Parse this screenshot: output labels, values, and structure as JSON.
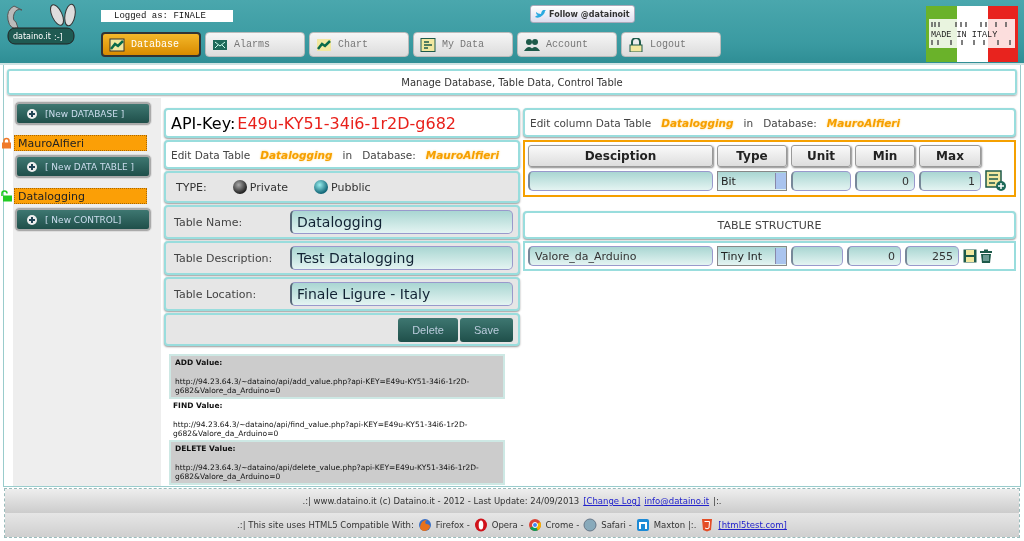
{
  "header": {
    "logo_text": "dataino.it",
    "logo_face": ":-]",
    "logged_as": "Logged as: FINALE",
    "twitter_button": "Follow @datainoit",
    "badge": "MADE IN ITALY",
    "nav": [
      {
        "label": "Database",
        "selected": true
      },
      {
        "label": "Alarms",
        "selected": false
      },
      {
        "label": "Chart",
        "selected": false
      },
      {
        "label": "My Data",
        "selected": false
      },
      {
        "label": "Account",
        "selected": false
      },
      {
        "label": "Logout",
        "selected": false
      }
    ]
  },
  "page_title": "Manage Database, Table Data, Control Table",
  "sidebar": {
    "items": [
      {
        "kind": "button",
        "label": "[New DATABASE ]"
      },
      {
        "kind": "entry",
        "label": "MauroAlfieri",
        "locked": true
      },
      {
        "kind": "button",
        "label": "[ New DATA TABLE ]"
      },
      {
        "kind": "entry",
        "label": "Datalogging",
        "locked": false
      },
      {
        "kind": "button",
        "label": "[ New CONTROL]"
      }
    ]
  },
  "api_key": {
    "label": "API-Key:",
    "value": "E49u-KY51-34i6-1r2D-g682"
  },
  "edit_table": {
    "prefix": "Edit Data Table",
    "table": "Datalogging",
    "in": "in",
    "database_label": "Database:",
    "database": "MauroAlfieri"
  },
  "type_row": {
    "label": "TYPE:",
    "options": [
      {
        "label": "Private",
        "selected": false
      },
      {
        "label": "Pubblic",
        "selected": true
      }
    ]
  },
  "fields": [
    {
      "label": "Table Name:",
      "value": "Datalogging"
    },
    {
      "label": "Table Description:",
      "value": "Test Datalogging"
    },
    {
      "label": "Table Location:",
      "value": "Finale Ligure - Italy"
    }
  ],
  "buttons": [
    "Delete",
    "Save"
  ],
  "api_examples": [
    {
      "title": "ADD Value:",
      "url": "http://94.23.64.3/~dataino/api/add_value.php?api-KEY=E49u-KY51-34i6-1r2D-g682&Valore_da_Arduino=0",
      "shaded": true
    },
    {
      "title": "FIND Value:",
      "url": "http://94.23.64.3/~dataino/api/find_value.php?api-KEY=E49u-KY51-34i6-1r2D-g682&Valore_da_Arduino=0",
      "shaded": false
    },
    {
      "title": "DELETE Value:",
      "url": "http://94.23.64.3/~dataino/api/delete_value.php?api-KEY=E49u-KY51-34i6-1r2D-g682&Valore_da_Arduino=0",
      "shaded": true
    }
  ],
  "edit_column": {
    "prefix": "Edit column Data Table",
    "table": "Datalogging",
    "in": "in",
    "database_label": "Database:",
    "database": "MauroAlfieri"
  },
  "new_column": {
    "columns": [
      "Desciption",
      "Type",
      "Unit",
      "Min",
      "Max"
    ],
    "type": "Bit",
    "min": "0",
    "max": "1"
  },
  "structure": {
    "title": "TABLE STRUCTURE",
    "rows": [
      {
        "description": "Valore_da_Arduino",
        "type": "Tiny Int",
        "min": "0",
        "max": "255"
      }
    ]
  },
  "footer": {
    "line1": ".:| www.dataino.it (c) Dataino.it - 2012 - Last Update: 24/09/2013",
    "links": [
      "[Change Log]",
      "info@dataino.it"
    ],
    "line1_end": "|:.",
    "line2": ".:| This site uses HTML5 Compatible With:",
    "browsers": [
      "Firefox -",
      "Opera -",
      "Crome -",
      "Safari -",
      "Maxton |:."
    ],
    "html5_link": "[html5test.com]"
  }
}
